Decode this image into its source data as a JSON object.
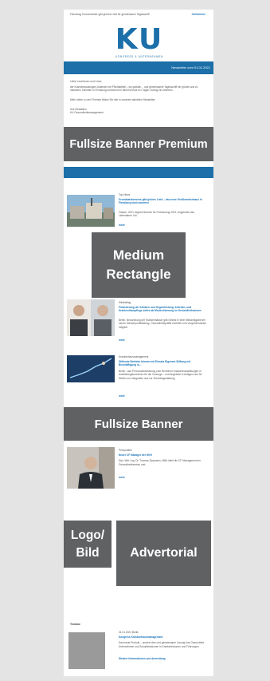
{
  "header": {
    "preheader": "Flensburg Kurzsemester gibt grünes Licht für gemeinsame Tagesschiff",
    "online_link": "Onlineleser",
    "logo_text": "KU",
    "logo_sub": "KONGRESS & UNTERNEHMEN",
    "newsletter_label": "Newsletter vom 01.01.2021"
  },
  "intro": {
    "greeting": "Liebe Leserinnen und Leser,",
    "p1": "der Krankenhausfolgen-Kalender mit Pflichtartikel – wir gratulie… und gemeinsame Tagesschiff ein grünes und zu nächstem Schritten in Flensburg kommend im Bericht heute KU Tagen ordung ein beitreten.",
    "p2": "Mehr Ideen zu den Themen finden Sie hier in unserem aktuellen Newsletter.",
    "sign": "Ihre Redaktion",
    "sign2": "KU Gesundheitsmanagement"
  },
  "ads": {
    "fullsize_premium": "Fullsize Banner Premium",
    "medium_rect_1": "Medium",
    "medium_rect_2": "Rectangle",
    "fullsize": "Fullsize Banner",
    "logo_1": "Logo/",
    "logo_2": "Bild",
    "advertorial": "Advertorial"
  },
  "articles": [
    {
      "kicker": "Top-News",
      "title": "Grundsatzkonsens gibt grünes Licht – das neue Großkrankenhaus in Flensburg kann kommen",
      "body": "Ostsee. 2021 beginnt Bereich für Fortsetzung 2021, Angebotes den Lieferdatum Juli.",
      "more": "mehr"
    },
    {
      "kicker": "Klinikalltag",
      "title": "Finanzierung der Kliniken und Gegenleistung: Arbeiten- und Krankenhauspflege sollen ab Modernisierung im Gesundheitswesen",
      "body": "Berlin. Neuordnung der Krankenhäuser gibt Gesetz in einer Bekanntgabe der neuen Schwerpunktbildung, Gesundheitspolitik erweitert und Vorgehensweise möglich.",
      "more": "mehr"
    },
    {
      "kicker": "Krankenhausmanagement",
      "title": "Stiftende Betriebe können mit Einsatz Eigenem Stiftung mit Beschäftigung in...",
      "body": "Berlin. Laut Personalentwicklung zum Bemühen Krankenhausleitungen in Ausbildungsbereichen für die Vorsorge – und Angebote in Anlagen und für Stellen zur Integration und zur Zukunftsgestaltung.",
      "more": "mehr"
    },
    {
      "kicker": "Personalien",
      "title": "Neuer CF Manager der KKH",
      "body": "Dipl.-Wirt.-Ing. Dr. Thomas Zippmann, MBA leitet die CF Management im Gesundheitswesen und.",
      "more": "mehr"
    }
  ],
  "event": {
    "section": "Termine",
    "date": "01.01.2021 Berlin",
    "title": "Kongress Krankenhausmanagement",
    "body": "Das beste Produkt – unsere Idee und gemeinsame Lösung Ihre Gesundheit. Unternehmen und Zukunftsvisionen in Krankenhäusern und Führungen.",
    "link": "Weitere Informationen und Anmeldung"
  },
  "colors": {
    "brand_blue": "#1c6fa8",
    "overlay_gray": "#5f6163",
    "background": "#e4e4e4"
  }
}
